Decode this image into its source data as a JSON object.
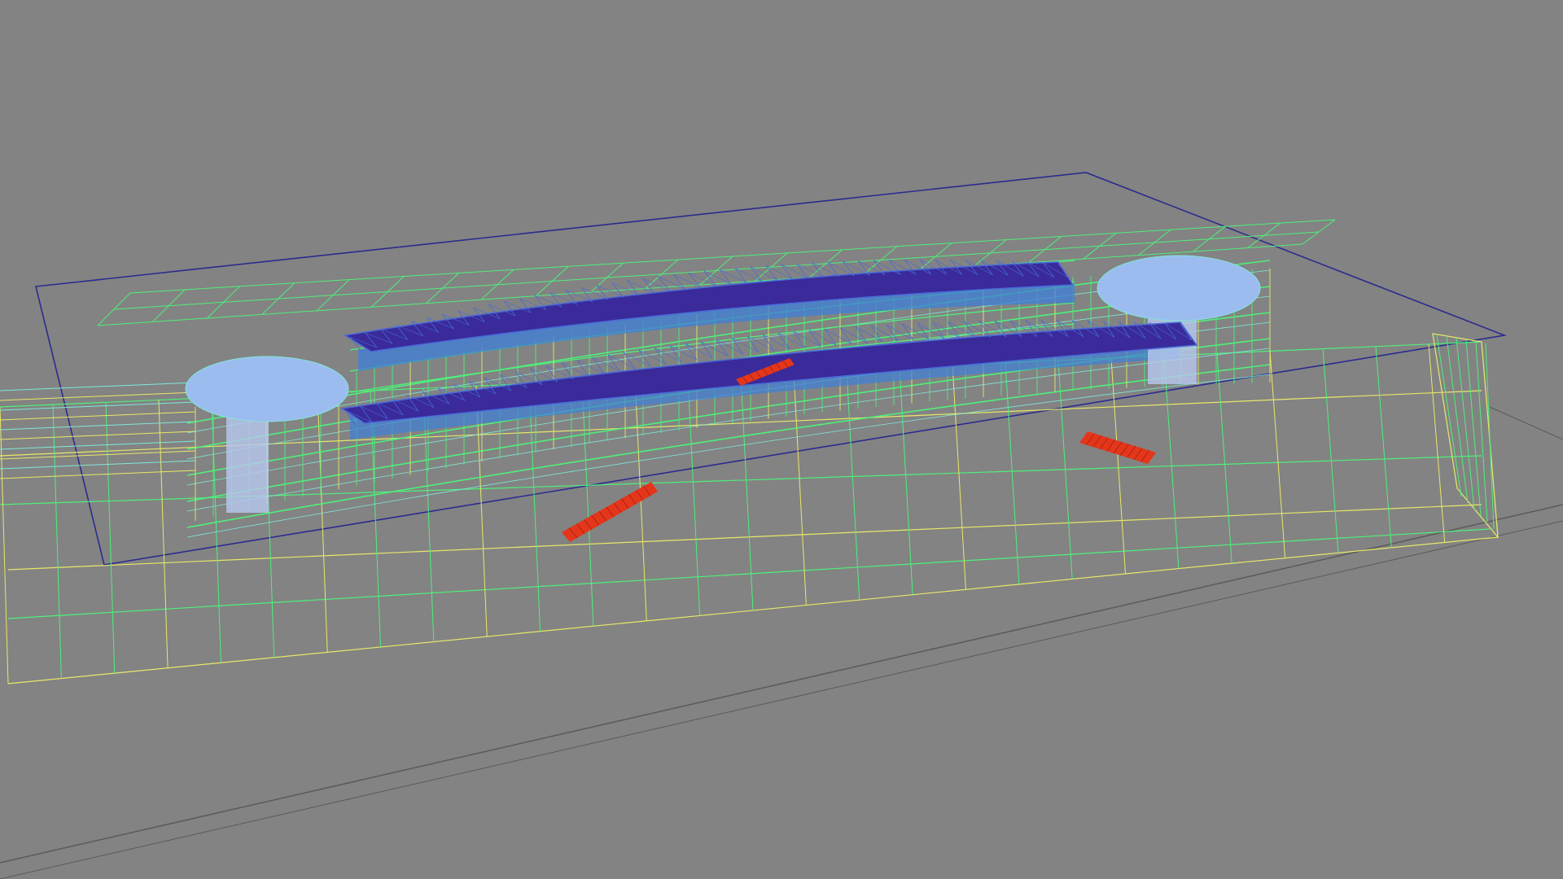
{
  "viewport": {
    "background_color": "#838383",
    "view_mode": "wireframe"
  },
  "colors": {
    "boundary": "#2b2b8f",
    "ground_line": "#5a5a5a",
    "wire_green": "#4ef07a",
    "wire_yellow": "#e8e86a",
    "wire_cyan": "#7fe8d8",
    "roof_purple": "#3a2a9a",
    "roof_blue": "#4a6ad8",
    "facade_blue": "#3e7fd8",
    "dome": "#9cbcf0",
    "stair_red": "#e4361a",
    "column": "#b8c8f0"
  },
  "scene_objects": {
    "boundary_plane": "site-boundary",
    "building": "wireframe-building",
    "roofs": [
      "roof-canopy-north",
      "roof-canopy-south"
    ],
    "domes": [
      "dome-west",
      "dome-east"
    ],
    "stairs": [
      "stair-left",
      "stair-right",
      "stair-inner"
    ]
  }
}
